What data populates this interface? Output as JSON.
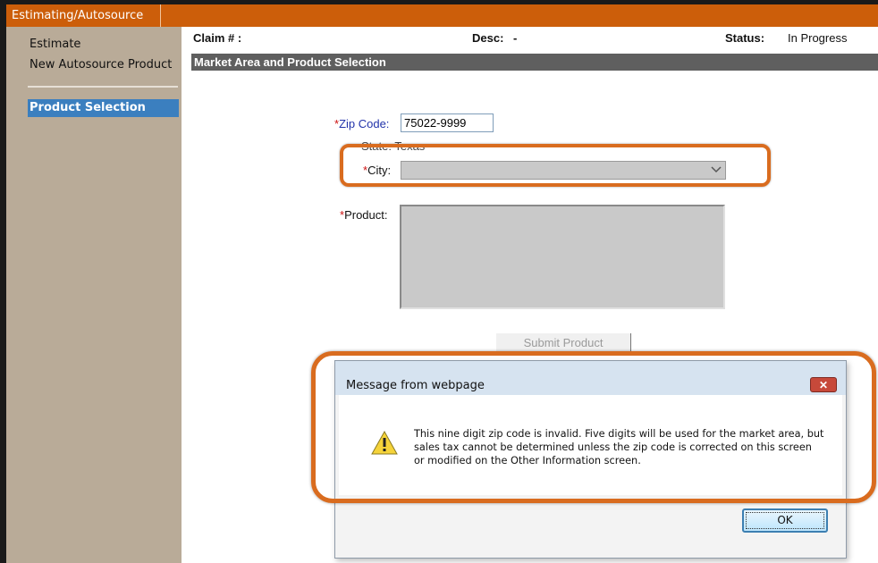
{
  "app": {
    "top_tab": "Estimating/Autosource"
  },
  "sidebar": {
    "items": [
      {
        "label": "Estimate"
      },
      {
        "label": "New Autosource Product"
      }
    ],
    "active_item": "Product Selection"
  },
  "header": {
    "claim_label": "Claim # :",
    "claim_value": "",
    "desc_label": "Desc:",
    "desc_value": "-",
    "status_label": "Status:",
    "status_value": "In Progress"
  },
  "section_title": "Market Area and Product Selection",
  "form": {
    "required_marker": "*",
    "zip_label": "Zip Code:",
    "zip_value": "75022-9999",
    "state_text": "State: Texas",
    "city_label": "City:",
    "city_value": "",
    "product_label": "Product:",
    "submit_label": "Submit Product"
  },
  "dialog": {
    "title": "Message from webpage",
    "message": "This nine digit zip code is invalid. Five digits will be used for the market area, but sales tax cannot be determined unless the zip code is corrected on this screen or modified on the Other Information screen.",
    "ok_label": "OK",
    "close_glyph": "✕",
    "icon": "warning-icon"
  },
  "colors": {
    "accent": "#cc5e0a",
    "sidebar_bg": "#b9ab98",
    "sidebar_active": "#3b7fbf",
    "section_bar": "#5f5f5f",
    "highlight": "#d96c1f"
  }
}
